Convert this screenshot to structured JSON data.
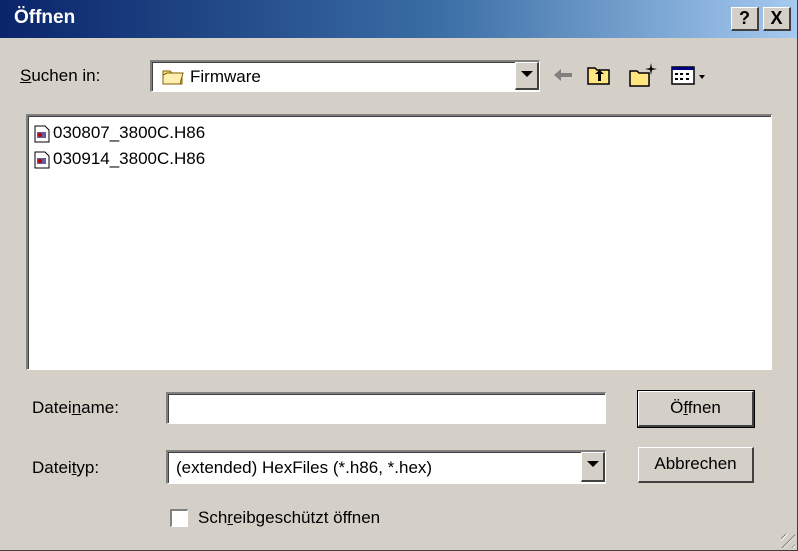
{
  "window": {
    "title": "Öffnen",
    "help_label": "?",
    "close_label": "X"
  },
  "look_in": {
    "label_prefix": "",
    "label_underlined": "S",
    "label_suffix": "uchen in:",
    "value": "Firmware"
  },
  "files": [
    {
      "name": "030807_3800C.H86"
    },
    {
      "name": "030914_3800C.H86"
    }
  ],
  "filename": {
    "label_prefix": "Datei",
    "label_underlined": "n",
    "label_suffix": "ame:",
    "value": ""
  },
  "filetype": {
    "label_prefix": "Datei",
    "label_underlined": "t",
    "label_suffix": "yp:",
    "value": "(extended) HexFiles (*.h86, *.hex)"
  },
  "readonly": {
    "label_prefix": "Sch",
    "label_underlined": "r",
    "label_suffix": "eibgeschützt öffnen",
    "checked": false
  },
  "buttons": {
    "open_prefix": "Ö",
    "open_underlined": "f",
    "open_suffix": "fnen",
    "cancel": "Abbrechen"
  },
  "colors": {
    "title_bar_start": "#0a246a",
    "title_bar_end": "#a6caf0",
    "dialog_face": "#d4d0c8"
  },
  "icons": [
    "folder-icon",
    "back-arrow-icon",
    "up-folder-icon",
    "new-folder-icon",
    "view-menu-icon",
    "file-icon"
  ]
}
